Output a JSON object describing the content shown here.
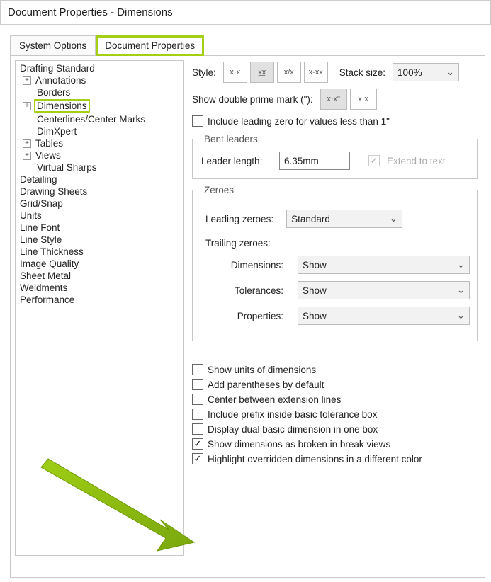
{
  "window": {
    "title": "Document Properties - Dimensions"
  },
  "tabs": {
    "system_options": "System Options",
    "document_properties": "Document Properties"
  },
  "tree": {
    "drafting_standard": "Drafting Standard",
    "annotations": "Annotations",
    "borders": "Borders",
    "dimensions": "Dimensions",
    "centerlines": "Centerlines/Center Marks",
    "dimxpert": "DimXpert",
    "tables": "Tables",
    "views": "Views",
    "virtual_sharps": "Virtual Sharps",
    "detailing": "Detailing",
    "drawing_sheets": "Drawing Sheets",
    "grid_snap": "Grid/Snap",
    "units": "Units",
    "line_font": "Line Font",
    "line_style": "Line Style",
    "line_thickness": "Line Thickness",
    "image_quality": "Image Quality",
    "sheet_metal": "Sheet Metal",
    "weldments": "Weldments",
    "performance": "Performance"
  },
  "style": {
    "label": "Style:",
    "btn1": "x·x",
    "btn2": "x͟x",
    "btn3": "x/x",
    "btn4": "x-xx"
  },
  "stack": {
    "label": "Stack size:",
    "value": "100%"
  },
  "prime": {
    "label": "Show double prime mark (\"):",
    "btn1": "x·x\"",
    "btn2": "x·x"
  },
  "include_leading_zero": "Include leading zero for values less than 1\"",
  "bent": {
    "legend": "Bent leaders",
    "leader_length_label": "Leader length:",
    "leader_length_value": "6.35mm",
    "extend_label": "Extend to text"
  },
  "zeroes": {
    "legend": "Zeroes",
    "leading_label": "Leading zeroes:",
    "leading_value": "Standard",
    "trailing_label": "Trailing zeroes:",
    "dimensions_label": "Dimensions:",
    "dimensions_value": "Show",
    "tolerances_label": "Tolerances:",
    "tolerances_value": "Show",
    "properties_label": "Properties:",
    "properties_value": "Show"
  },
  "checks": {
    "show_units": "Show units of dimensions",
    "add_paren": "Add parentheses by default",
    "center_ext": "Center between extension lines",
    "include_prefix": "Include prefix inside basic tolerance box",
    "dual_basic": "Display dual basic dimension in one box",
    "broken_break": "Show dimensions as broken in break views",
    "highlight_overridden": "Highlight overridden dimensions in a different color"
  }
}
